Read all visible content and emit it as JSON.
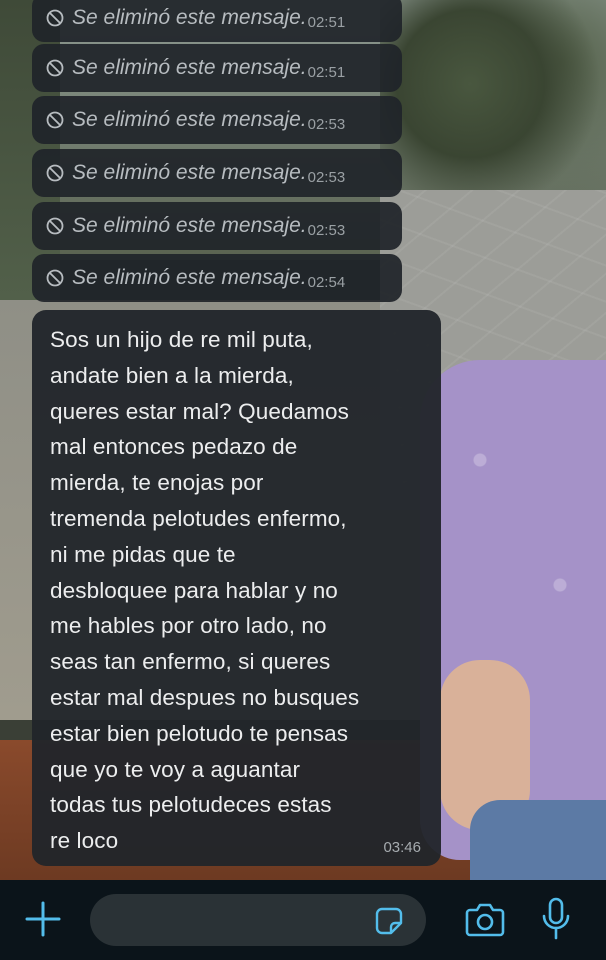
{
  "deleted_messages": [
    {
      "text": "Se eliminó este mensaje.",
      "time": "02:51"
    },
    {
      "text": "Se eliminó este mensaje.",
      "time": "02:51"
    },
    {
      "text": "Se eliminó este mensaje.",
      "time": "02:53"
    },
    {
      "text": "Se eliminó este mensaje.",
      "time": "02:53"
    },
    {
      "text": "Se eliminó este mensaje.",
      "time": "02:53"
    },
    {
      "text": "Se eliminó este mensaje.",
      "time": "02:54"
    }
  ],
  "message": {
    "lines": "Sos un hijo de re mil puta,\nandate bien a la mierda,\nqueres estar mal? Quedamos\nmal entonces pedazo de\nmierda, te enojas por\ntremenda pelotudes enfermo,\nni me pidas que te\ndesbloquee para hablar y no\nme hables por otro lado, no\nseas tan enfermo, si queres\nestar mal despues no busques\nestar bien pelotudo te pensas\nque yo te voy a aguantar\ntodas tus pelotudeces estas\nre loco",
    "time": "03:46"
  },
  "input_bar": {
    "icons": [
      "plus-icon",
      "sticker-icon",
      "camera-icon",
      "mic-icon"
    ],
    "placeholder": "",
    "accent_color": "#53bdeb"
  }
}
